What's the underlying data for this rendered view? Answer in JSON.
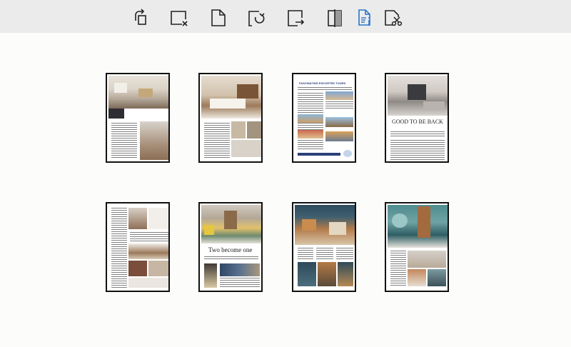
{
  "toolbar": {
    "buttons": [
      {
        "name": "rotate-page-button",
        "icon": "rotate-page-icon"
      },
      {
        "name": "delete-page-button",
        "icon": "delete-page-icon"
      },
      {
        "name": "insert-blank-page-button",
        "icon": "blank-page-icon"
      },
      {
        "name": "rotate-clockwise-button",
        "icon": "rotate-clockwise-icon"
      },
      {
        "name": "extract-page-button",
        "icon": "extract-page-icon"
      },
      {
        "name": "split-page-button",
        "icon": "split-page-icon"
      },
      {
        "name": "page-info-button",
        "icon": "page-info-icon"
      },
      {
        "name": "cut-page-button",
        "icon": "cut-page-icon"
      }
    ],
    "accent": "#2a74c9"
  },
  "pages": [
    {
      "label": "page-1",
      "heading": ""
    },
    {
      "label": "page-2",
      "heading": ""
    },
    {
      "label": "page-3",
      "heading": "FASCINATING ESCORTED TOURS"
    },
    {
      "label": "page-4",
      "heading": "GOOD TO BE BACK"
    },
    {
      "label": "page-5",
      "heading": ""
    },
    {
      "label": "page-6",
      "heading": "Two become one"
    },
    {
      "label": "page-7",
      "heading": ""
    },
    {
      "label": "page-8",
      "heading": ""
    }
  ]
}
